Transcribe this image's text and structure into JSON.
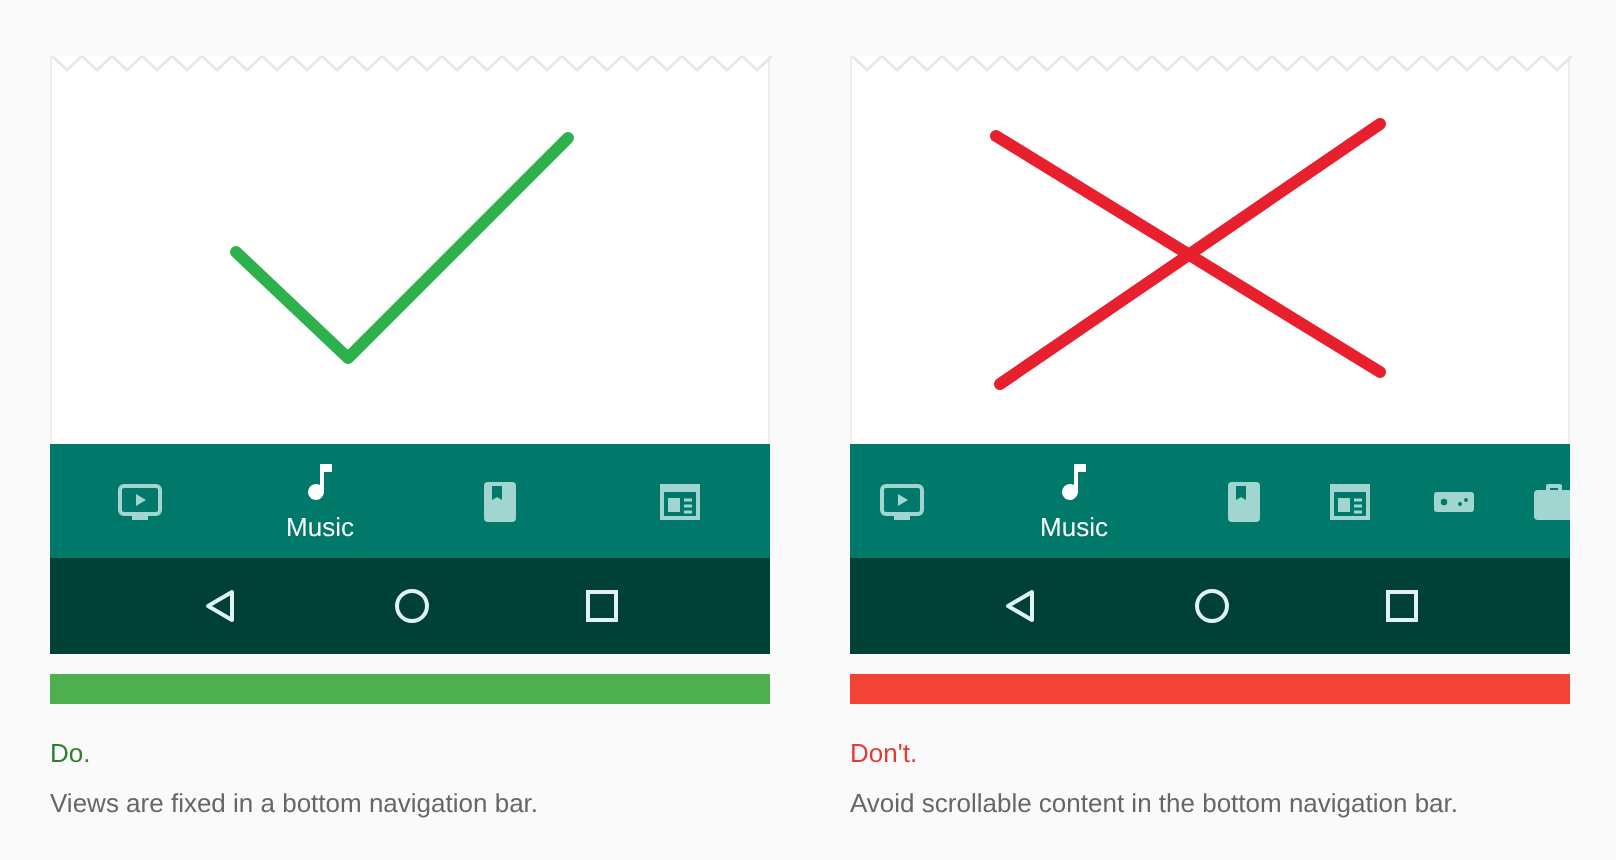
{
  "panels": [
    {
      "kind": "do",
      "nav_items": [
        {
          "kind": "tv",
          "selected": false
        },
        {
          "kind": "music",
          "label": "Music",
          "selected": true
        },
        {
          "kind": "book",
          "selected": false
        },
        {
          "kind": "news",
          "selected": false
        }
      ],
      "verdict": "Do.",
      "caption": "Views are fixed in a bottom navigation bar."
    },
    {
      "kind": "dont",
      "nav_items": [
        {
          "kind": "tv",
          "selected": false
        },
        {
          "kind": "music",
          "label": "Music",
          "selected": true
        },
        {
          "kind": "book",
          "selected": false
        },
        {
          "kind": "news",
          "selected": false
        },
        {
          "kind": "game",
          "selected": false
        },
        {
          "kind": "bag",
          "selected": false
        }
      ],
      "verdict": "Don't.",
      "caption": "Avoid scrollable content in the bottom navigation bar."
    }
  ]
}
